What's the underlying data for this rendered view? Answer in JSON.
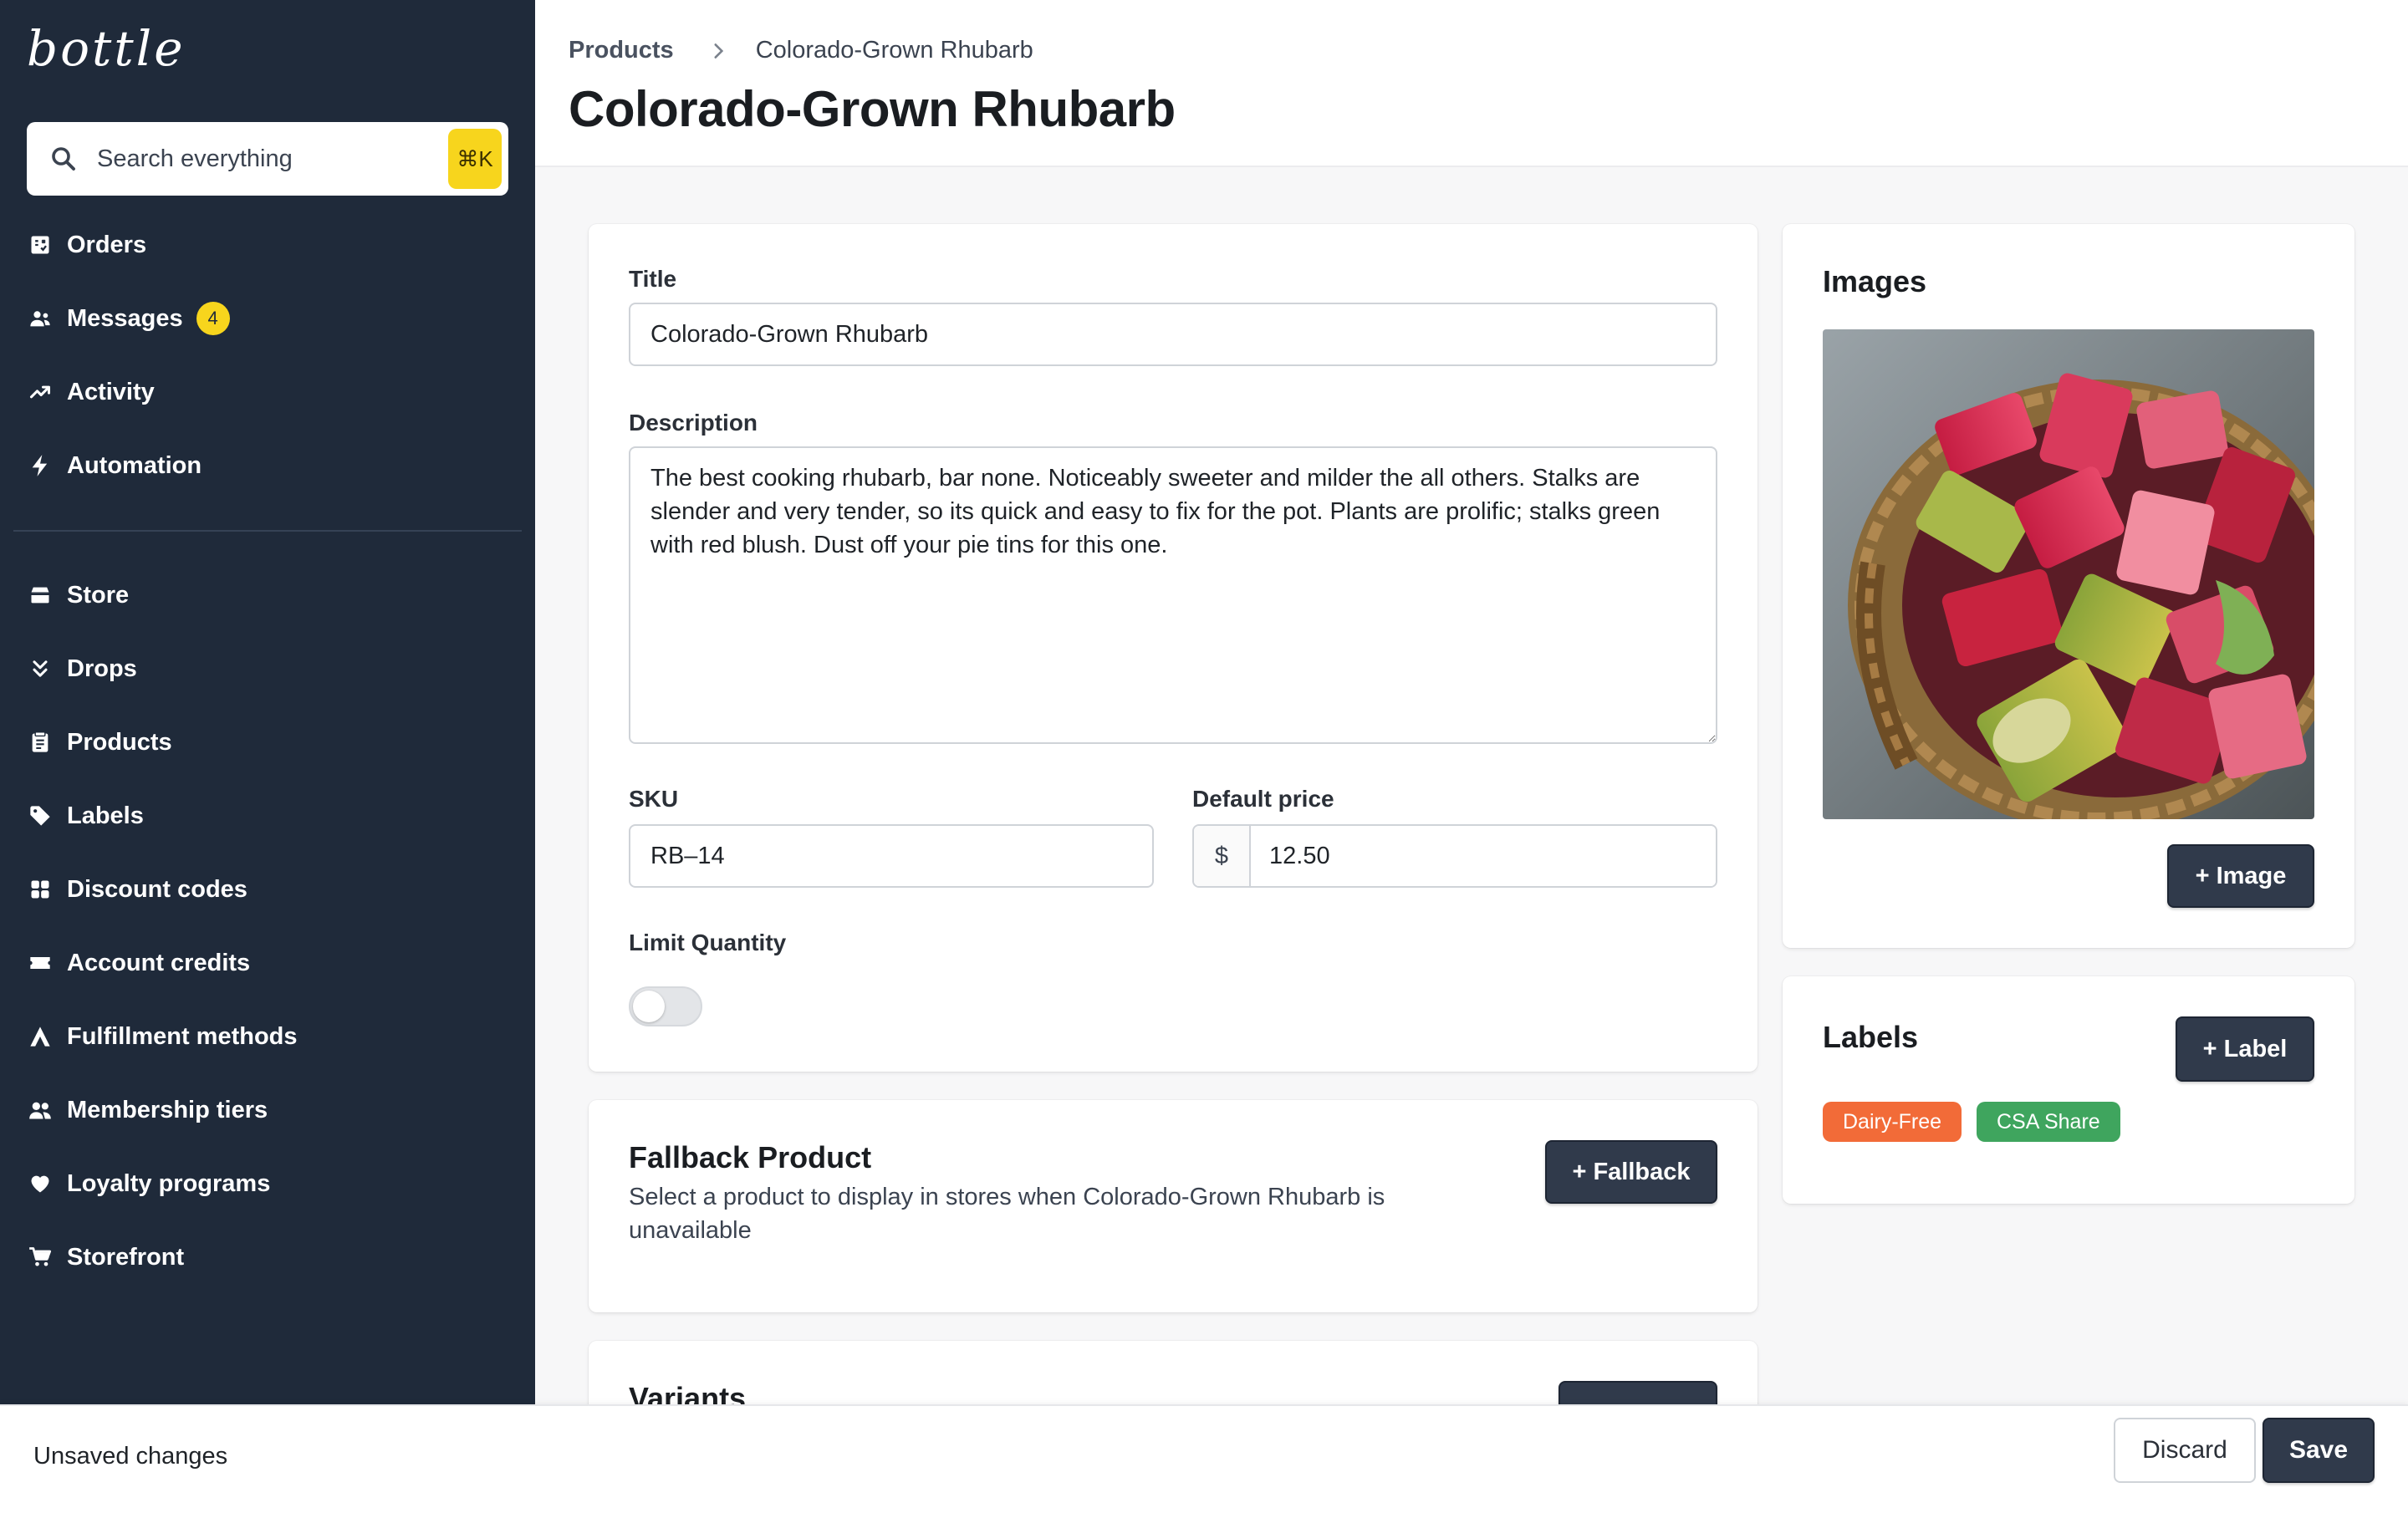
{
  "app": {
    "logo": "bottle"
  },
  "search": {
    "placeholder": "Search everything",
    "shortcut": "⌘K"
  },
  "sidebar": {
    "primary": [
      {
        "label": "Orders",
        "icon": "orders-icon"
      },
      {
        "label": "Messages",
        "icon": "messages-icon",
        "badge": "4"
      },
      {
        "label": "Activity",
        "icon": "activity-icon"
      },
      {
        "label": "Automation",
        "icon": "lightning-icon"
      }
    ],
    "secondary": [
      {
        "label": "Store",
        "icon": "store-icon"
      },
      {
        "label": "Drops",
        "icon": "drops-icon"
      },
      {
        "label": "Products",
        "icon": "products-icon"
      },
      {
        "label": "Labels",
        "icon": "label-icon"
      },
      {
        "label": "Discount codes",
        "icon": "discount-icon"
      },
      {
        "label": "Account credits",
        "icon": "credits-icon"
      },
      {
        "label": "Fulfillment methods",
        "icon": "fulfillment-icon"
      },
      {
        "label": "Membership tiers",
        "icon": "membership-icon"
      },
      {
        "label": "Loyalty programs",
        "icon": "heart-icon"
      },
      {
        "label": "Storefront",
        "icon": "cart-icon"
      }
    ]
  },
  "header": {
    "breadcrumb": {
      "parent": "Products",
      "current": "Colorado-Grown Rhubarb"
    },
    "title": "Colorado-Grown Rhubarb"
  },
  "form": {
    "title_label": "Title",
    "title_value": "Colorado-Grown Rhubarb",
    "description_label": "Description",
    "description_value": "The best cooking rhubarb, bar none. Noticeably sweeter and milder the all others. Stalks are slender and very tender, so its quick and easy to fix for the pot. Plants are prolific; stalks green with red blush. Dust off your pie tins for this one.",
    "sku_label": "SKU",
    "sku_value": "RB–14",
    "price_label": "Default price",
    "currency": "$",
    "price_value": "12.50",
    "limit_label": "Limit Quantity",
    "limit_enabled": false
  },
  "fallback": {
    "title": "Fallback Product",
    "description": "Select a product to display in stores when Colorado-Grown Rhubarb is unavailable",
    "button": "+ Fallback"
  },
  "variants": {
    "title": "Variants"
  },
  "images": {
    "title": "Images",
    "button": "+ Image"
  },
  "labels": {
    "title": "Labels",
    "button": "+ Label",
    "tags": [
      {
        "text": "Dairy-Free",
        "color": "#f26b38"
      },
      {
        "text": "CSA Share",
        "color": "#3fa55e"
      }
    ]
  },
  "bottom_bar": {
    "status": "Unsaved changes",
    "discard": "Discard",
    "save": "Save"
  },
  "colors": {
    "sidebar": "#1f2a3a",
    "accent": "#f7d51d",
    "button": "#303a4b"
  }
}
